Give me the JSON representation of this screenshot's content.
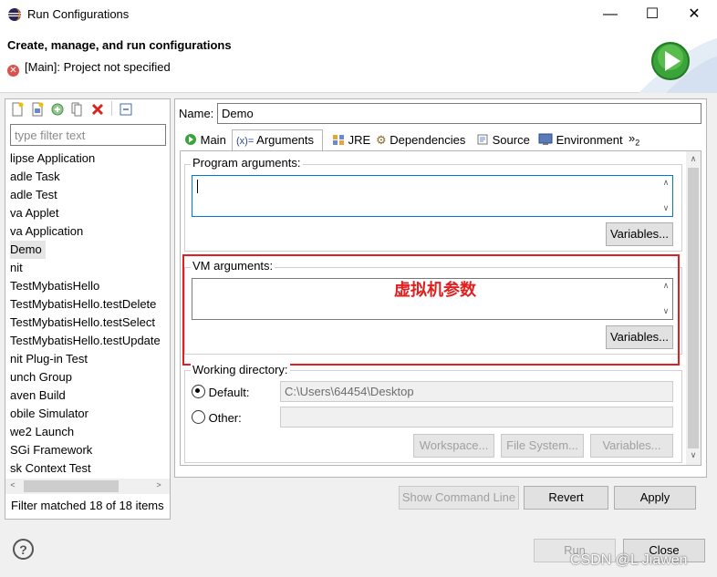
{
  "window": {
    "title": "Run Configurations",
    "minimize": "—",
    "maximize": "☐",
    "close": "✕"
  },
  "header": {
    "title": "Create, manage, and run configurations",
    "error": "[Main]: Project not specified"
  },
  "left": {
    "filter_placeholder": "type filter text",
    "items": [
      "lipse Application",
      "adle Task",
      "adle Test",
      "va Applet",
      "va Application",
      "Demo",
      "nit",
      "TestMybatisHello",
      "TestMybatisHello.testDelete",
      "TestMybatisHello.testSelect",
      "TestMybatisHello.testUpdate",
      "nit Plug-in Test",
      "unch Group",
      "aven Build",
      "obile Simulator",
      "we2 Launch",
      "SGi Framework",
      "sk Context Test"
    ],
    "selected_index": 5,
    "footer": "Filter matched 18 of 18 items"
  },
  "config": {
    "name_label": "Name:",
    "name_value": "Demo",
    "tabs": [
      "Main",
      "Arguments",
      "JRE",
      "Dependencies",
      "Source",
      "Environment"
    ],
    "overflow": "»",
    "overflow_count": "2",
    "active_tab": "Arguments",
    "program_args_label": "Program arguments:",
    "vm_args_label": "VM arguments:",
    "variables_label": "Variables...",
    "annotation": "虚拟机参数",
    "working_dir_label": "Working directory:",
    "default_label": "Default:",
    "default_value": "C:\\Users\\64454\\Desktop",
    "other_label": "Other:",
    "workspace_btn": "Workspace...",
    "filesystem_btn": "File System...",
    "variables_btn": "Variables..."
  },
  "bottom": {
    "show_command_line": "Show Command Line",
    "revert": "Revert",
    "apply": "Apply",
    "run": "Run",
    "close": "Close",
    "help": "?"
  },
  "watermark": "CSDN @L Jiawen",
  "colors": {
    "annotation_red": "#e02020",
    "accent_blue": "#0078d7",
    "run_green": "#3aa33a"
  }
}
